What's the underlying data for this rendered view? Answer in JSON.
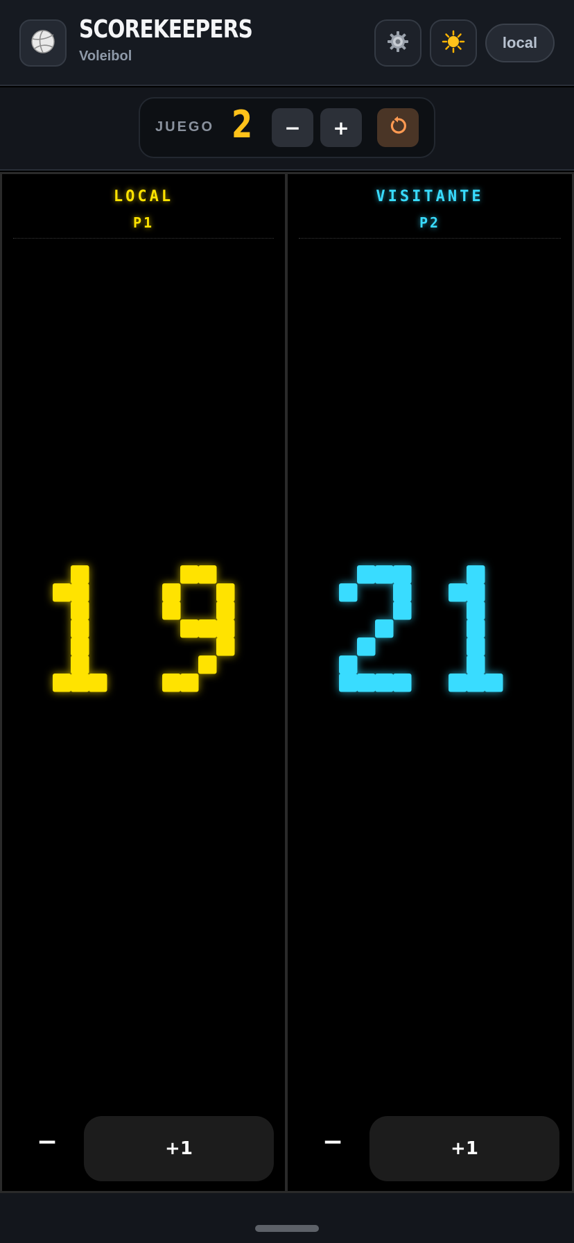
{
  "header": {
    "logo_icon": "volleyball-icon",
    "title": "SCOREKEEPERS",
    "subtitle": "Voleibol",
    "settings_icon": "gear-icon",
    "theme_icon": "sun-icon",
    "mode_label": "local"
  },
  "game": {
    "label": "JUEGO",
    "number": "2",
    "minus_label": "−",
    "plus_label": "+",
    "reset_icon": "reset-icon"
  },
  "teams": [
    {
      "name": "LOCAL",
      "player": "P1",
      "score": "19",
      "color": "#ffe300",
      "minus_label": "−",
      "plus_label": "+1"
    },
    {
      "name": "VISITANTE",
      "player": "P2",
      "score": "21",
      "color": "#39dcff",
      "minus_label": "−",
      "plus_label": "+1"
    }
  ],
  "colors": {
    "header_bg": "#161a21",
    "game_number": "#ffc21a",
    "reset_button_bg": "#4a3526"
  }
}
